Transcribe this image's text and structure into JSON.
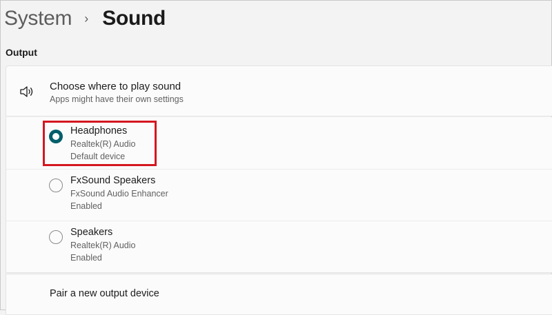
{
  "breadcrumb": {
    "parent": "System",
    "separator": "›",
    "current": "Sound"
  },
  "section": {
    "label": "Output"
  },
  "output_selector": {
    "icon": "speaker-icon",
    "title": "Choose where to play sound",
    "subtitle": "Apps might have their own settings"
  },
  "devices": [
    {
      "name": "Headphones",
      "line2": "Realtek(R) Audio",
      "line3": "Default device",
      "selected": true
    },
    {
      "name": "FxSound Speakers",
      "line2": "FxSound Audio Enhancer",
      "line3": "Enabled",
      "selected": false
    },
    {
      "name": "Speakers",
      "line2": "Realtek(R) Audio",
      "line3": "Enabled",
      "selected": false
    }
  ],
  "pair": {
    "label": "Pair a new output device"
  },
  "colors": {
    "accent": "#005f6b",
    "highlight": "#d4161f",
    "background": "#f3f3f3",
    "card": "#fbfbfb"
  }
}
